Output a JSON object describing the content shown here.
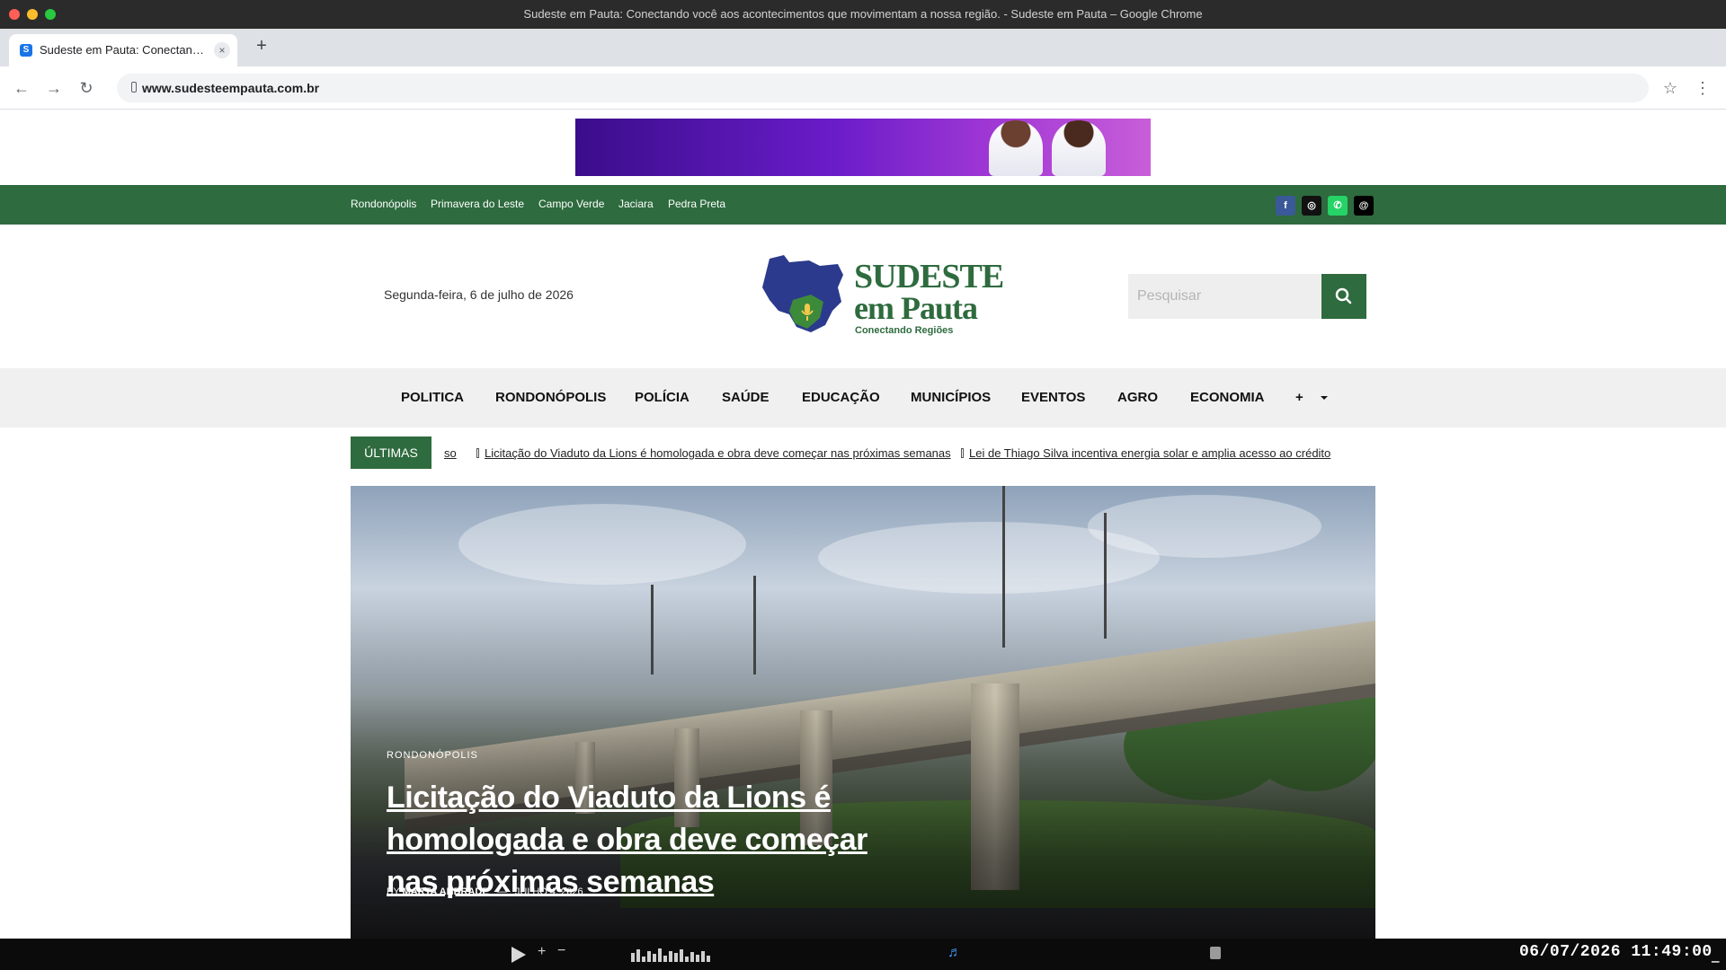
{
  "window": {
    "title": "Sudeste em Pauta: Conectando você aos acontecimentos que movimentam a nossa região. - Sudeste em Pauta – Google Chrome"
  },
  "tab": {
    "favicon_letter": "S",
    "title": "Sudeste em Pauta: Conectando você aos acontecimentos",
    "close": "×",
    "new_tab": "+"
  },
  "toolbar": {
    "back": "←",
    "forward": "→",
    "reload": "↻",
    "url": "www.sudesteempauta.com.br",
    "star": "☆",
    "menu": "⋮"
  },
  "topbar": {
    "cities": [
      "Rondonópolis",
      "Primavera do Leste",
      "Campo Verde",
      "Jaciara",
      "Pedra Preta"
    ],
    "social": [
      {
        "name": "facebook-icon",
        "glyph": "f",
        "color": "#3b5998"
      },
      {
        "name": "instagram-icon",
        "glyph": "◎",
        "color": "#111111"
      },
      {
        "name": "whatsapp-icon",
        "glyph": "✆",
        "color": "#25d366"
      },
      {
        "name": "threads-icon",
        "glyph": "@",
        "color": "#000000"
      }
    ]
  },
  "header": {
    "date": "Segunda-feira, 6 de julho de 2026",
    "logo_line1": "SUDESTE",
    "logo_line2": "em Pauta",
    "logo_tagline": "Conectando Regiões",
    "search_placeholder": "Pesquisar"
  },
  "nav": {
    "items": [
      "POLITICA",
      "RONDONÓPOLIS",
      "POLÍCIA",
      "SAÚDE",
      "EDUCAÇÃO",
      "MUNICÍPIOS",
      "EVENTOS",
      "AGRO",
      "ECONOMIA",
      "+"
    ]
  },
  "ticker": {
    "label": "ÚLTIMAS",
    "items": [
      "so",
      "Licitação do Viaduto da Lions é homologada e obra deve começar nas próximas semanas",
      "Lei de Thiago Silva incentiva energia solar e amplia acesso ao crédito"
    ]
  },
  "hero": {
    "category": "RONDONÓPOLIS",
    "title": "Licitação do Viaduto da Lions é homologada e obra deve começar nas próximas semanas",
    "by": "BY",
    "author": "MARTA ANDRADE",
    "separator": "—",
    "date": "JULHO 4, 2026"
  },
  "sysbar": {
    "plus": "+",
    "minus": "−",
    "music": "♬",
    "clock": "06/07/2026 11:49:00",
    "tray_end": "▁"
  }
}
